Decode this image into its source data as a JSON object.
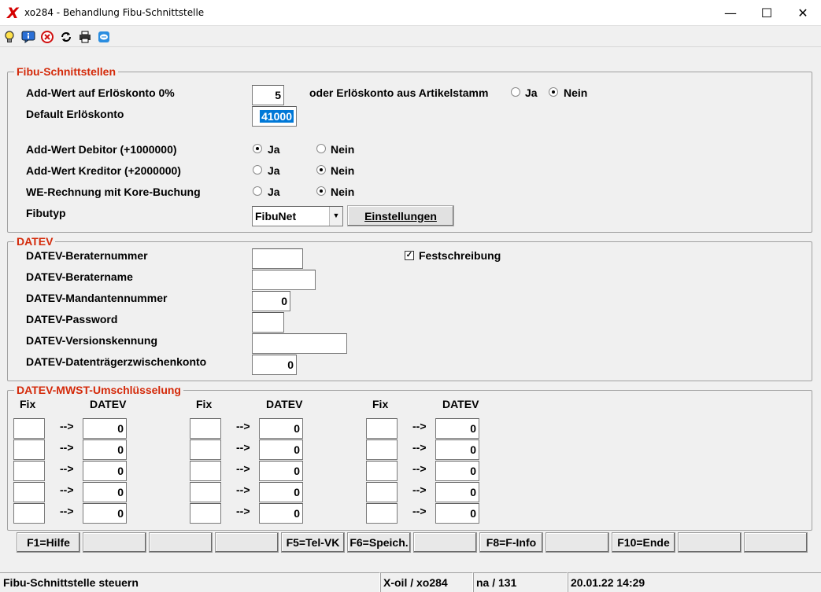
{
  "window": {
    "title": "xo284 - Behandlung Fibu-Schnittstelle",
    "app_icon": "X",
    "minimize": "—",
    "maximize": "☐",
    "close": "✕"
  },
  "toolbar": {
    "icons": [
      "lightbulb-icon",
      "info-icon",
      "cancel-icon",
      "refresh-icon",
      "print-icon",
      "chat-icon"
    ]
  },
  "fibu": {
    "legend": "Fibu-Schnittstellen",
    "addwert_label": "Add-Wert auf Erlöskonto 0%",
    "addwert_value": "5",
    "oder_label": "oder Erlöskonto aus Artikelstamm",
    "default_label": "Default Erlöskonto",
    "default_value": "41000",
    "debitor_label": "Add-Wert Debitor (+1000000)",
    "kreditor_label": "Add-Wert Kreditor (+2000000)",
    "we_label": "WE-Rechnung mit Kore-Buchung",
    "fibutyp_label": "Fibutyp",
    "fibutyp_value": "FibuNet",
    "einstellungen": "Einstellungen",
    "ja": "Ja",
    "nein": "Nein",
    "artikelstamm_selected": "Nein",
    "debitor_selected": "Ja",
    "kreditor_selected": "Nein",
    "we_selected": "Nein"
  },
  "datev": {
    "legend": "DATEV",
    "beraternummer_label": "DATEV-Beraternummer",
    "beraternummer_value": "",
    "beratername_label": "DATEV-Beratername",
    "beratername_value": "",
    "mandant_label": "DATEV-Mandantennummer",
    "mandant_value": "0",
    "password_label": "DATEV-Password",
    "password_value": "",
    "version_label": "DATEV-Versionskennung",
    "version_value": "",
    "zwischenkonto_label": "DATEV-Datenträgerzwischenkonto",
    "zwischenkonto_value": "0",
    "festschreibung_label": "Festschreibung",
    "festschreibung_checked": true
  },
  "mwst": {
    "legend": "DATEV-MWST-Umschlüsselung",
    "fix_header": "Fix",
    "datev_header": "DATEV",
    "arrow": "-->",
    "columns": [
      {
        "rows": [
          {
            "fix": "",
            "datev": "0"
          },
          {
            "fix": "",
            "datev": "0"
          },
          {
            "fix": "",
            "datev": "0"
          },
          {
            "fix": "",
            "datev": "0"
          },
          {
            "fix": "",
            "datev": "0"
          }
        ]
      },
      {
        "rows": [
          {
            "fix": "",
            "datev": "0"
          },
          {
            "fix": "",
            "datev": "0"
          },
          {
            "fix": "",
            "datev": "0"
          },
          {
            "fix": "",
            "datev": "0"
          },
          {
            "fix": "",
            "datev": "0"
          }
        ]
      },
      {
        "rows": [
          {
            "fix": "",
            "datev": "0"
          },
          {
            "fix": "",
            "datev": "0"
          },
          {
            "fix": "",
            "datev": "0"
          },
          {
            "fix": "",
            "datev": "0"
          },
          {
            "fix": "",
            "datev": "0"
          }
        ]
      }
    ]
  },
  "fkeys": [
    "F1=Hilfe",
    "",
    "",
    "",
    "F5=Tel-VK",
    "F6=Speich.",
    "",
    "F8=F-Info",
    "",
    "F10=Ende",
    "",
    ""
  ],
  "statusbar": {
    "message": "Fibu-Schnittstelle steuern",
    "program": "X-oil / xo284",
    "user": "na / 131",
    "datetime": "20.01.22 14:29"
  }
}
